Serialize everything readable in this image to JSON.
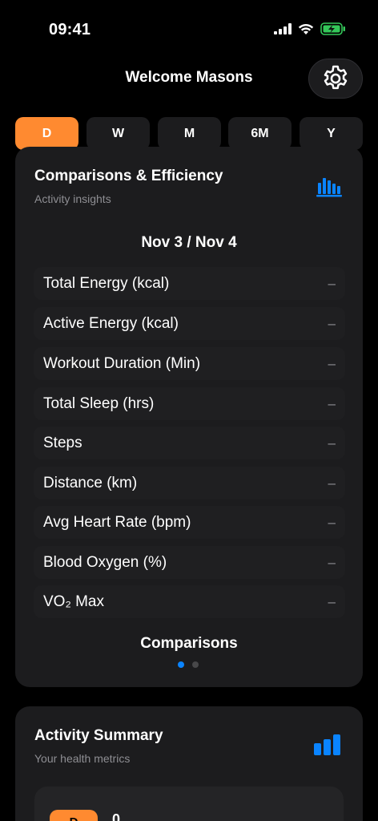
{
  "status": {
    "time": "09:41"
  },
  "header": {
    "title": "Welcome Masons"
  },
  "segments": [
    "D",
    "W",
    "M",
    "6M",
    "Y"
  ],
  "colors": {
    "accent": "#ff8a30",
    "blue": "#0a84ff",
    "card": "#1c1c1e"
  },
  "comparisons_card": {
    "title": "Comparisons & Efficiency",
    "subtitle": "Activity insights",
    "icon": "bar-chart-icon",
    "date": "Nov 3 / Nov 4",
    "metrics": [
      {
        "label": "Total Energy (kcal)",
        "value": "–"
      },
      {
        "label": "Active Energy (kcal)",
        "value": "–"
      },
      {
        "label": "Workout Duration (Min)",
        "value": "–"
      },
      {
        "label": "Total Sleep (hrs)",
        "value": "–"
      },
      {
        "label": "Steps",
        "value": "–"
      },
      {
        "label": "Distance (km)",
        "value": "–"
      },
      {
        "label": "Avg Heart Rate (bpm)",
        "value": "–"
      },
      {
        "label": "Blood Oxygen (%)",
        "value": "–"
      },
      {
        "label": "VO₂ Max",
        "value": "–"
      }
    ],
    "footer_label": "Comparisons",
    "pager": {
      "pages": 2,
      "current": 1
    }
  },
  "summary_card": {
    "title": "Activity Summary",
    "subtitle": "Your health metrics",
    "icon": "signal-bars-icon",
    "badge": "D",
    "value": "0"
  }
}
